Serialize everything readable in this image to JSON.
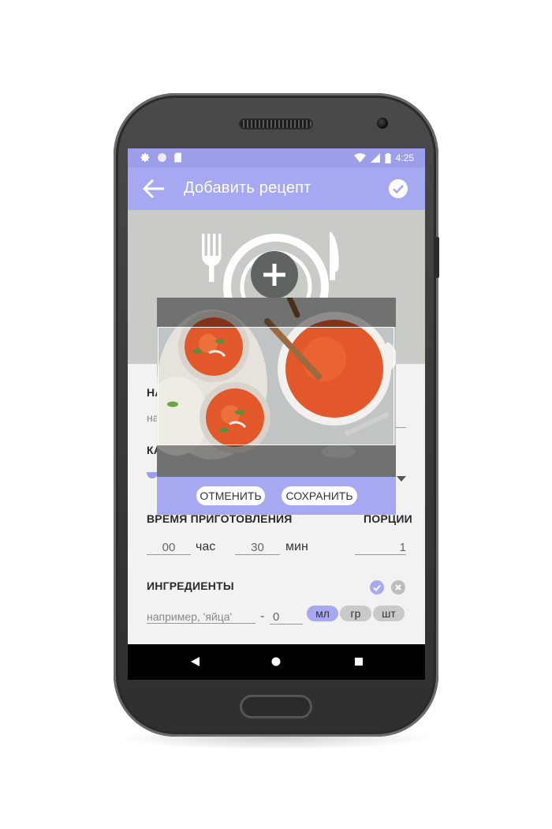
{
  "status": {
    "time": "4:25"
  },
  "appbar": {
    "title": "Добавить рецепт"
  },
  "form": {
    "name_label": "НА",
    "name_placeholder": "на",
    "category_label": "КА",
    "time_label": "ВРЕМЯ ПРИГОТОВЛЕНИЯ",
    "portions_label": "ПОРЦИИ",
    "hours_value": "00",
    "hours_unit": "час",
    "minutes_value": "30",
    "minutes_unit": "мин",
    "portions_value": "1",
    "ingredients_label": "ИНГРЕДИЕНТЫ",
    "ingredient_placeholder": "например, 'яйца'",
    "dash": "-",
    "quantity_value": "0",
    "units": [
      "мл",
      "гр",
      "шт"
    ],
    "selected_unit": "мл"
  },
  "crop": {
    "cancel_label": "ОТМЕНИТЬ",
    "save_label": "СОХРАНИТЬ"
  },
  "colors": {
    "accent": "#a7a8f2",
    "status": "#9d9ee9",
    "hero": "#c8cbc6",
    "soup": "#e3582b"
  }
}
